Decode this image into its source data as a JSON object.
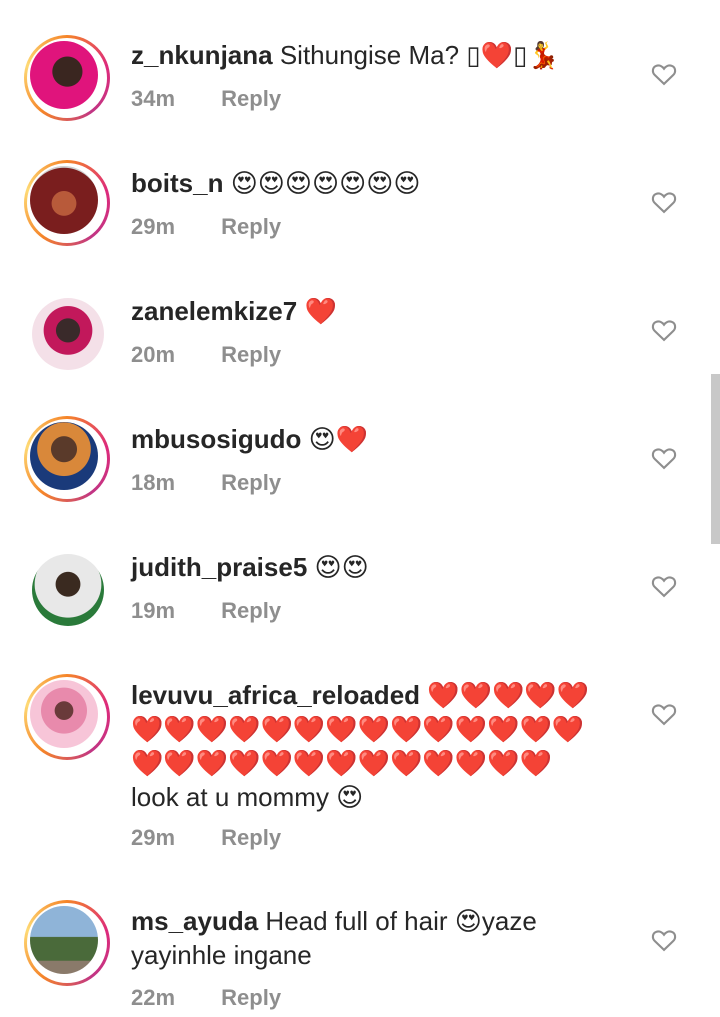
{
  "comments": [
    {
      "username": "z_nkunjana",
      "text": "Sithungise Ma? ",
      "emoji": "▯❤️▯💃",
      "time": "34m",
      "reply": "Reply",
      "avatar_colors": [
        "#e0147c",
        "#2b1a1a"
      ]
    },
    {
      "username": "boits_n",
      "text": "",
      "emoji": "😍😍😍😍😍😍😍",
      "time": "29m",
      "reply": "Reply",
      "avatar_colors": [
        "#7a1e1e",
        "#b85a3a"
      ]
    },
    {
      "username": "zanelemkize7",
      "text": "",
      "emoji": "❤️",
      "time": "20m",
      "reply": "Reply",
      "avatar_colors": [
        "#f4b8c8",
        "#3a2a2a"
      ]
    },
    {
      "username": "mbusosigudo",
      "text": "",
      "emoji": "😍❤️",
      "time": "18m",
      "reply": "Reply",
      "avatar_colors": [
        "#1a3a7a",
        "#d9883a"
      ]
    },
    {
      "username": "judith_praise5",
      "text": "",
      "emoji": "😍😍",
      "time": "19m",
      "reply": "Reply",
      "avatar_colors": [
        "#e8e8e8",
        "#2a7a3a"
      ]
    },
    {
      "username": "levuvu_africa_reloaded",
      "text": "",
      "emoji": "❤️❤️❤️❤️❤️",
      "line2": "❤️❤️❤️❤️❤️❤️❤️❤️❤️❤️❤️❤️❤️❤️",
      "line3": "❤️❤️❤️❤️❤️❤️❤️❤️❤️❤️❤️❤️❤️",
      "line4": "look at u mommy ",
      "line4_emoji": "😍",
      "time": "29m",
      "reply": "Reply",
      "avatar_colors": [
        "#f7c5d8",
        "#e88aac"
      ]
    },
    {
      "username": "ms_ayuda",
      "text": "Head full of hair ",
      "emoji": "😍",
      "text2": "yaze",
      "line2": "yayinhle ingane",
      "time": "22m",
      "reply": "Reply",
      "avatar_colors": [
        "#8fb4d8",
        "#4a6a3a"
      ]
    }
  ],
  "icons": {
    "like": "heart-outline-icon"
  },
  "colors": {
    "text": "#262626",
    "meta": "#8e8e8e",
    "heart": "#e0245e"
  }
}
